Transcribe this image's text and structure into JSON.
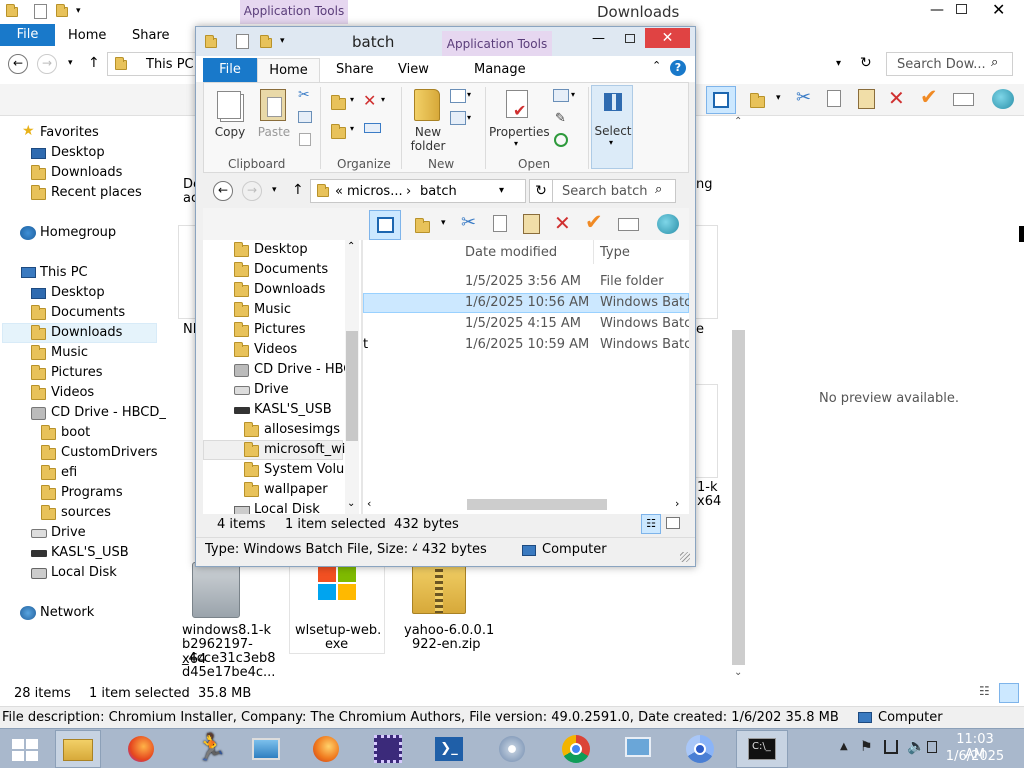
{
  "bg": {
    "apptools": "Application Tools",
    "title": "Downloads",
    "tabs": [
      "File",
      "Home",
      "Share"
    ],
    "address": "This PC",
    "search_placeholder": "Search Dow...",
    "sidebar": {
      "favorites": "Favorites",
      "fav_items": [
        "Desktop",
        "Downloads",
        "Recent places"
      ],
      "homegroup": "Homegroup",
      "thispc": "This PC",
      "pc_items": [
        "Desktop",
        "Documents",
        "Downloads",
        "Music",
        "Pictures",
        "Videos"
      ],
      "cd": "CD Drive - HBCD_",
      "cd_items": [
        "boot",
        "CustomDrivers",
        "efi",
        "Programs",
        "sources"
      ],
      "drive": "Drive",
      "usb": "KASL'S_USB",
      "local": "Local Disk",
      "network": "Network"
    },
    "files": [
      {
        "name": "windows8.1-kb2962197-x64_4cce31c3eb8d45e17be4c...",
        "l1": "windows8.1-k",
        "l2": "b2962197-x64",
        "l3": "_4cce31c3eb8",
        "l4": "d45e17be4c..."
      },
      {
        "name": "wlsetup-web.exe",
        "l1": "wlsetup-web.",
        "l2": "exe"
      },
      {
        "name": "yahoo-6.0.0.1922-en.zip",
        "l1": "yahoo-6.0.0.1",
        "l2": "922-en.zip"
      }
    ],
    "partial_labels": {
      "de": "De",
      "ac": "ac",
      "ng": "ng",
      "ni": "NI",
      "e": "e",
      "k": "1-k",
      "x64": "x64",
      "t": "t"
    },
    "preview": "No preview available.",
    "status_items": "28 items",
    "status_selected": "1 item selected  35.8 MB",
    "details": "File description: Chromium Installer, Company: The Chromium Authors, File version: 49.0.2591.0, Date created: 1/6/202 35.8 MB",
    "computer": "Computer"
  },
  "fg": {
    "title": "batch",
    "apptools": "Application Tools",
    "tabs": {
      "file": "File",
      "home": "Home",
      "share": "Share",
      "view": "View",
      "manage": "Manage"
    },
    "ribbon": {
      "copy": "Copy",
      "paste": "Paste",
      "clipboard": "Clipboard",
      "organize": "Organize",
      "new_folder_1": "New",
      "new_folder_2": "folder",
      "new": "New",
      "properties": "Properties",
      "open": "Open",
      "select": "Select"
    },
    "address": {
      "prefix": "«",
      "part1": "micros...",
      "sep": "›",
      "part2": "batch"
    },
    "search_placeholder": "Search batch",
    "tree": [
      "Desktop",
      "Documents",
      "Downloads",
      "Music",
      "Pictures",
      "Videos",
      "CD Drive - HBC",
      "Drive",
      "KASL'S_USB",
      "allosesimgs",
      "microsoft_wi",
      "System Volur",
      "wallpaper",
      "Local Disk"
    ],
    "columns": {
      "date": "Date modified",
      "type": "Type"
    },
    "rows": [
      {
        "name": "",
        "date": "1/5/2025 3:56 AM",
        "type": "File folder"
      },
      {
        "name": "",
        "date": "1/6/2025 10:56 AM",
        "type": "Windows Batc"
      },
      {
        "name": "",
        "date": "1/5/2025 4:15 AM",
        "type": "Windows Batc"
      },
      {
        "name": "t",
        "date": "1/6/2025 10:59 AM",
        "type": "Windows Batc"
      }
    ],
    "status_items": "4 items",
    "status_selected": "1 item selected  432 bytes",
    "details_type": "Type: Windows Batch File, Size: 4",
    "details_size": "432 bytes",
    "details_loc": "Computer"
  },
  "taskbar": {
    "time": "11:03 AM",
    "date": "1/6/2025"
  },
  "colors": {
    "accent": "#1979ca",
    "apptools": "#e6d7f0",
    "selected": "#cce8ff",
    "close": "#e04343",
    "taskbar": "#a9b8cc"
  }
}
